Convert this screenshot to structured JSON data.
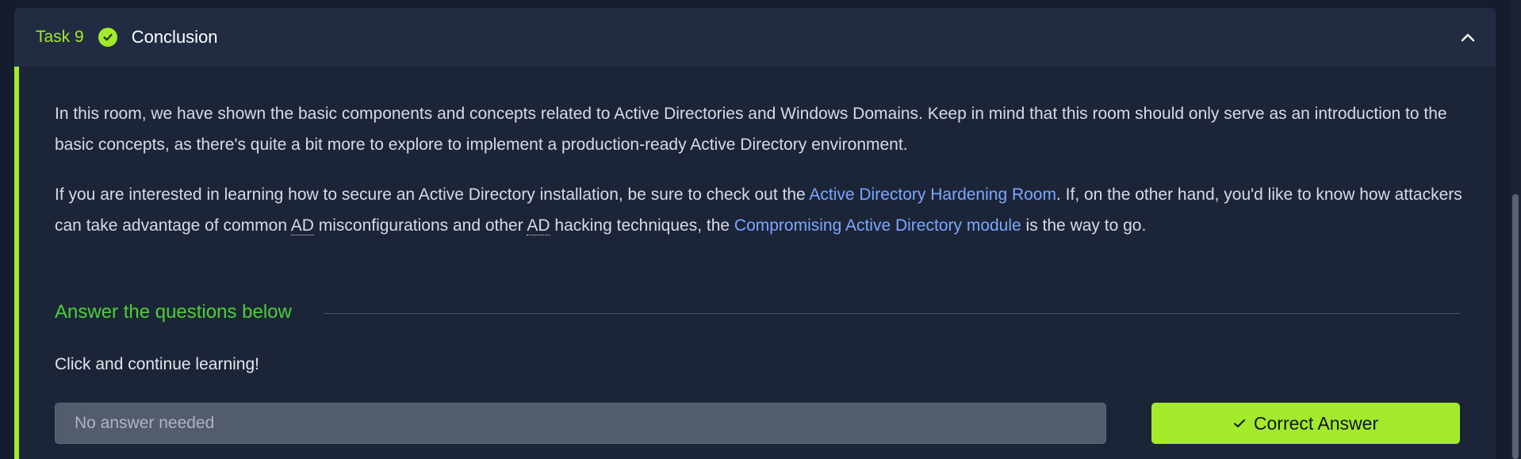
{
  "task": {
    "number_label": "Task 9",
    "title": "Conclusion",
    "status_icon": "check-circle-icon",
    "collapse_icon": "chevron-up-icon"
  },
  "content": {
    "p1": "In this room, we have shown the basic components and concepts related to Active Directories and Windows Domains. Keep in mind that this room should only serve as an introduction to the basic concepts, as there's quite a bit more to explore to implement a production-ready Active Directory environment.",
    "p2_part1": "If you are interested in learning how to secure an Active Directory installation, be sure to check out the ",
    "p2_link1": "Active Directory Hardening Room",
    "p2_part2": ". If, on the other hand, you'd like to know how attackers can take advantage of common ",
    "p2_abbr1": "AD",
    "p2_part3": " misconfigurations and other ",
    "p2_abbr2": "AD",
    "p2_part4": " hacking techniques, the ",
    "p2_link2": "Compromising Active Directory module",
    "p2_part5": " is the way to go."
  },
  "questions": {
    "heading": "Answer the questions below",
    "q1_text": "Click and continue learning!",
    "q1_placeholder": "No answer needed",
    "q1_button": "Correct Answer"
  },
  "colors": {
    "accent": "#a3ea2a",
    "heading_green": "#4ccf38",
    "link": "#7ba7ff",
    "background": "#1c2538"
  }
}
